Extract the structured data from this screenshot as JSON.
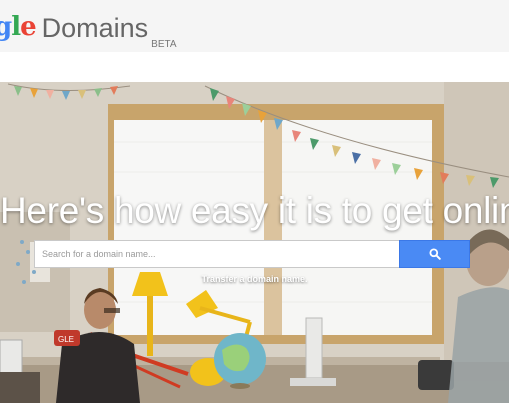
{
  "header": {
    "logo": {
      "google_letters": [
        "g",
        "l",
        "e"
      ],
      "product_name": "Domains",
      "badge": "BETA"
    }
  },
  "hero": {
    "headline": "Here's how easy it is to get online",
    "search": {
      "placeholder": "Search for a domain name...",
      "value": "",
      "button_icon": "search-icon"
    },
    "transfer_link": "Transfer a domain name."
  },
  "colors": {
    "search_button": "#4a8af4",
    "header_bg": "#f5f5f5"
  }
}
